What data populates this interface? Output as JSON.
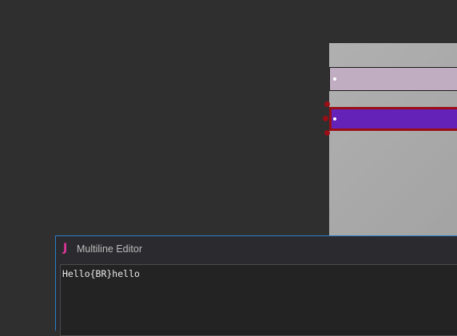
{
  "editor": {
    "app_icon_glyph": "J",
    "title": "Multiline Editor",
    "text_value": "Hello{BR}hello"
  },
  "canvas": {
    "nodes": [
      {
        "name": "node-unselected",
        "fill": "#c1adc1",
        "selected": false
      },
      {
        "name": "node-selected",
        "fill": "#6522b8",
        "selected": true,
        "selection_color": "#9a0f16"
      }
    ]
  },
  "colors": {
    "background": "#2f2f2f",
    "canvas_panel": "#a8a8a8",
    "editor_border_accent": "#2b7fc9",
    "app_icon_accent": "#e0359a"
  }
}
